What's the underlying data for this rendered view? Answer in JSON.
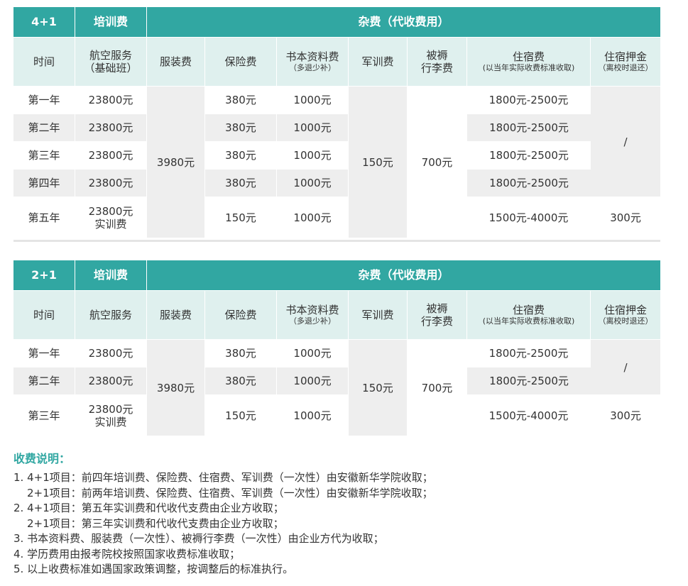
{
  "table1": {
    "program": "4+1",
    "training_fee_header": "培训费",
    "misc_header": "杂费（代收费用）",
    "col_time": "时间",
    "col_aviation_l1": "航空服务",
    "col_aviation_l2": "（基础班）",
    "col_uniform": "服装费",
    "col_insurance": "保险费",
    "col_books": "书本资料费",
    "col_books_note": "（多退少补）",
    "col_military": "军训费",
    "col_bedding_l1": "被褥",
    "col_bedding_l2": "行李费",
    "col_lodging": "住宿费",
    "col_lodging_note": "(以当年实际收费标准收取)",
    "col_deposit": "住宿押金",
    "col_deposit_note": "（离校时退还）",
    "uniform_value": "3980元",
    "military_value": "150元",
    "bedding_value": "700元",
    "deposit_slash": "/",
    "rows": [
      {
        "year": "第一年",
        "tuition": "23800元",
        "insurance": "380元",
        "books": "1000元",
        "lodging": "1800元-2500元"
      },
      {
        "year": "第二年",
        "tuition": "23800元",
        "insurance": "380元",
        "books": "1000元",
        "lodging": "1800元-2500元"
      },
      {
        "year": "第三年",
        "tuition": "23800元",
        "insurance": "380元",
        "books": "1000元",
        "lodging": "1800元-2500元"
      },
      {
        "year": "第四年",
        "tuition": "23800元",
        "insurance": "380元",
        "books": "1000元",
        "lodging": "1800元-2500元"
      }
    ],
    "last_row": {
      "year": "第五年",
      "tuition_l1": "23800元",
      "tuition_l2": "实训费",
      "insurance": "150元",
      "books": "1000元",
      "lodging": "1500元-4000元",
      "deposit": "300元"
    }
  },
  "table2": {
    "program": "2+1",
    "training_fee_header": "培训费",
    "misc_header": "杂费（代收费用）",
    "col_time": "时间",
    "col_aviation": "航空服务",
    "col_uniform": "服装费",
    "col_insurance": "保险费",
    "col_books": "书本资料费",
    "col_books_note": "（多退少补）",
    "col_military": "军训费",
    "col_bedding_l1": "被褥",
    "col_bedding_l2": "行李费",
    "col_lodging": "住宿费",
    "col_lodging_note": "(以当年实际收费标准收取)",
    "col_deposit": "住宿押金",
    "col_deposit_note": "（离校时退还）",
    "uniform_value": "3980元",
    "military_value": "150元",
    "bedding_value": "700元",
    "deposit_slash": "/",
    "rows": [
      {
        "year": "第一年",
        "tuition": "23800元",
        "insurance": "380元",
        "books": "1000元",
        "lodging": "1800元-2500元"
      },
      {
        "year": "第二年",
        "tuition": "23800元",
        "insurance": "380元",
        "books": "1000元",
        "lodging": "1800元-2500元"
      }
    ],
    "last_row": {
      "year": "第三年",
      "tuition_l1": "23800元",
      "tuition_l2": "实训费",
      "insurance": "150元",
      "books": "1000元",
      "lodging": "1500元-4000元",
      "deposit": "300元"
    }
  },
  "notes": {
    "title": "收费说明：",
    "lines": [
      "1. 4+1项目：前四年培训费、保险费、住宿费、军训费（一次性）由安徽新华学院收取；",
      "2+1项目：前两年培训费、保险费、住宿费、军训费（一次性）由安徽新华学院收取；",
      "2. 4+1项目：第五年实训费和代收代支费由企业方收取；",
      "2+1项目：第三年实训费和代收代支费由企业方收取；",
      "3. 书本资料费、服装费（一次性）、被褥行李费（一次性）由企业方代为收取；",
      "4. 学历费用由报考院校按照国家收费标准收取；",
      "5. 以上收费标准如遇国家政策调整，按调整后的标准执行。"
    ]
  },
  "colors": {
    "teal": "#31a7a2",
    "header_light": "#dff0ee",
    "row_gray": "#eeeeee"
  }
}
